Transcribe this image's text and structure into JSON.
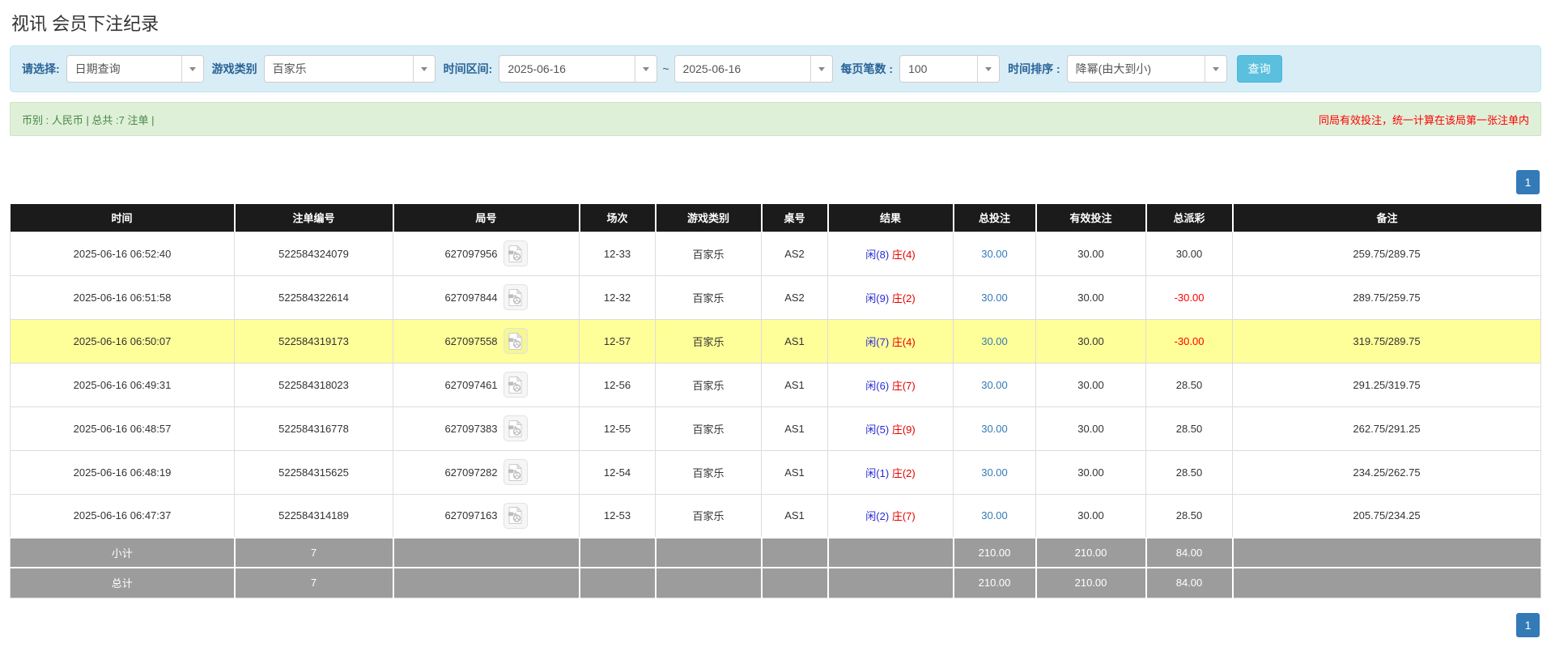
{
  "page": {
    "title": "视讯 会员下注纪录"
  },
  "filters": {
    "query_type": {
      "label": "请选择:",
      "value": "日期查询"
    },
    "game_category": {
      "label": "游戏类别",
      "value": "百家乐"
    },
    "time_range": {
      "label": "时间区间:",
      "from": "2025-06-16",
      "separator": "~",
      "to": "2025-06-16"
    },
    "page_size": {
      "label": "每页笔数 :",
      "value": "100"
    },
    "time_sort": {
      "label": "时间排序 :",
      "value": "降幂(由大到小)"
    },
    "search_button_label": "查询"
  },
  "summary_bar": {
    "left_text": "币别 : 人民币 | 总共 :7 注单 |",
    "right_text": "同局有效投注，统一计算在该局第一张注单内"
  },
  "pagination": {
    "current_page": "1"
  },
  "table": {
    "headers": [
      "时间",
      "注单编号",
      "局号",
      "场次",
      "游戏类别",
      "桌号",
      "结果",
      "总投注",
      "有效投注",
      "总派彩",
      "备注"
    ],
    "rows": [
      {
        "time": "2025-06-16 06:52:40",
        "bet_id": "522584324079",
        "round_id": "627097956",
        "session": "12-33",
        "game": "百家乐",
        "table_no": "AS2",
        "result_player": "闲(8)",
        "result_banker": "庄(4)",
        "total_bet": "30.00",
        "valid_bet": "30.00",
        "payout": "30.00",
        "payout_negative": false,
        "note": "259.75/289.75",
        "highlight": false
      },
      {
        "time": "2025-06-16 06:51:58",
        "bet_id": "522584322614",
        "round_id": "627097844",
        "session": "12-32",
        "game": "百家乐",
        "table_no": "AS2",
        "result_player": "闲(9)",
        "result_banker": "庄(2)",
        "total_bet": "30.00",
        "valid_bet": "30.00",
        "payout": "-30.00",
        "payout_negative": true,
        "note": "289.75/259.75",
        "highlight": false
      },
      {
        "time": "2025-06-16 06:50:07",
        "bet_id": "522584319173",
        "round_id": "627097558",
        "session": "12-57",
        "game": "百家乐",
        "table_no": "AS1",
        "result_player": "闲(7)",
        "result_banker": "庄(4)",
        "total_bet": "30.00",
        "valid_bet": "30.00",
        "payout": "-30.00",
        "payout_negative": true,
        "note": "319.75/289.75",
        "highlight": true
      },
      {
        "time": "2025-06-16 06:49:31",
        "bet_id": "522584318023",
        "round_id": "627097461",
        "session": "12-56",
        "game": "百家乐",
        "table_no": "AS1",
        "result_player": "闲(6)",
        "result_banker": "庄(7)",
        "total_bet": "30.00",
        "valid_bet": "30.00",
        "payout": "28.50",
        "payout_negative": false,
        "note": "291.25/319.75",
        "highlight": false
      },
      {
        "time": "2025-06-16 06:48:57",
        "bet_id": "522584316778",
        "round_id": "627097383",
        "session": "12-55",
        "game": "百家乐",
        "table_no": "AS1",
        "result_player": "闲(5)",
        "result_banker": "庄(9)",
        "total_bet": "30.00",
        "valid_bet": "30.00",
        "payout": "28.50",
        "payout_negative": false,
        "note": "262.75/291.25",
        "highlight": false
      },
      {
        "time": "2025-06-16 06:48:19",
        "bet_id": "522584315625",
        "round_id": "627097282",
        "session": "12-54",
        "game": "百家乐",
        "table_no": "AS1",
        "result_player": "闲(1)",
        "result_banker": "庄(2)",
        "total_bet": "30.00",
        "valid_bet": "30.00",
        "payout": "28.50",
        "payout_negative": false,
        "note": "234.25/262.75",
        "highlight": false
      },
      {
        "time": "2025-06-16 06:47:37",
        "bet_id": "522584314189",
        "round_id": "627097163",
        "session": "12-53",
        "game": "百家乐",
        "table_no": "AS1",
        "result_player": "闲(2)",
        "result_banker": "庄(7)",
        "total_bet": "30.00",
        "valid_bet": "30.00",
        "payout": "28.50",
        "payout_negative": false,
        "note": "205.75/234.25",
        "highlight": false
      }
    ],
    "subtotal": {
      "label": "小计",
      "count": "7",
      "total_bet": "210.00",
      "valid_bet": "210.00",
      "payout": "84.00"
    },
    "total": {
      "label": "总计",
      "count": "7",
      "total_bet": "210.00",
      "valid_bet": "210.00",
      "payout": "84.00"
    }
  },
  "colors": {
    "filter_panel_bg": "#d9edf7",
    "filter_label_blue": "#2a6496",
    "search_button_bg": "#5bc0de",
    "summary_bar_bg": "#dff0d8",
    "summary_text_green": "#468847",
    "notice_text_red": "#ff0000",
    "table_header_bg": "#1b1b1b",
    "highlight_row_yellow": "#ffff99",
    "summary_row_gray": "#9c9c9c",
    "link_blue": "#337ab7",
    "result_player_blue": "#2929d6",
    "result_banker_red": "#e60000",
    "negative_payout_red": "#ff0000",
    "pagination_active_bg": "#337ab7"
  }
}
